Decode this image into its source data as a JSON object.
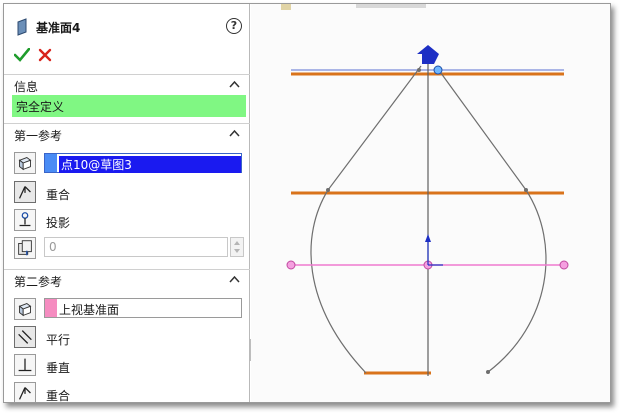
{
  "property_manager": {
    "title": "基准面4",
    "help_icon": "help-icon",
    "help_glyph": "?",
    "ok_icon": "checkmark-icon",
    "cancel_icon": "close-icon"
  },
  "info_section": {
    "title": "信息",
    "status": "完全定义",
    "status_color": "#80f783"
  },
  "first_reference": {
    "title": "第一参考",
    "selection": "点10@草图3",
    "selection_color": "#4a8cf5",
    "options": [
      {
        "label": "重合",
        "icon": "coincident-icon"
      },
      {
        "label": "投影",
        "icon": "projection-icon"
      }
    ],
    "distance_value": "0"
  },
  "second_reference": {
    "title": "第二参考",
    "selection": "上视基准面",
    "selection_color": "#f58cc0",
    "options": [
      {
        "label": "平行",
        "icon": "parallel-icon"
      },
      {
        "label": "垂直",
        "icon": "perpendicular-icon"
      },
      {
        "label": "重合",
        "icon": "coincident-icon"
      }
    ]
  },
  "colors": {
    "plane_edge": "#d9731b",
    "selected_plane": "#f07ad0",
    "axis_arrow": "#1d2fc4",
    "sketch_line": "#6e6e6e"
  }
}
